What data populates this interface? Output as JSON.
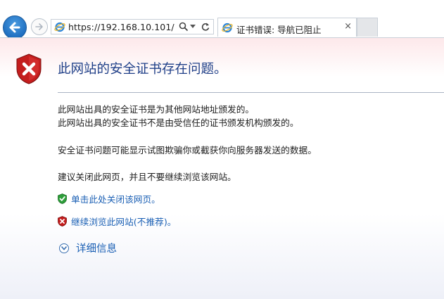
{
  "browser": {
    "url": "https://192.168.10.101/",
    "tab_title": "证书错误: 导航已阻止",
    "tab_close": "×",
    "icons": [
      "back-arrow-icon",
      "forward-arrow-icon",
      "ie-logo-icon",
      "search-icon",
      "dropdown-icon",
      "refresh-icon"
    ]
  },
  "page": {
    "heading": "此网站的安全证书存在问题。",
    "reason_1": "此网站出具的安全证书是为其他网站地址颁发的。",
    "reason_2": "此网站出具的安全证书不是由受信任的证书颁发机构颁发的。",
    "explanation": "安全证书问题可能显示试图欺骗你或截获你向服务器发送的数据。",
    "recommendation": "建议关闭此网页，并且不要继续浏览该网站。",
    "close_link": "单击此处关闭该网页。",
    "continue_link": "继续浏览此网站(不推荐)。",
    "more_info": "详细信息"
  },
  "colors": {
    "heading": "#1f3f88",
    "link": "#1a5fb4",
    "error_shield": "#cc1f1f",
    "safe_shield": "#2e9e3a"
  }
}
